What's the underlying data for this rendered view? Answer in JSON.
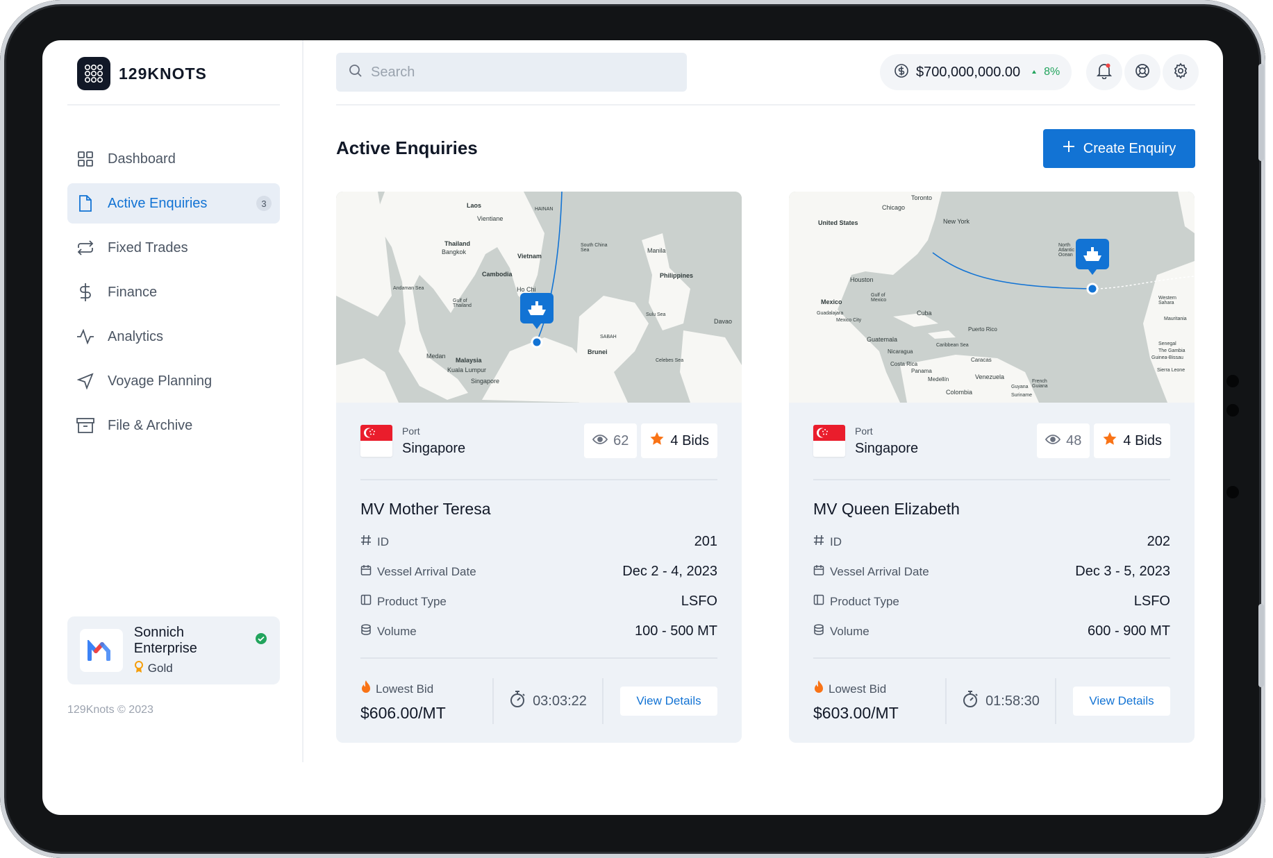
{
  "app": {
    "name": "129KNOTS"
  },
  "sidebar": {
    "items": [
      {
        "label": "Dashboard",
        "icon": "grid-icon"
      },
      {
        "label": "Active Enquiries",
        "icon": "document-icon",
        "badge": "3"
      },
      {
        "label": "Fixed Trades",
        "icon": "swap-icon"
      },
      {
        "label": "Finance",
        "icon": "dollar-icon"
      },
      {
        "label": "Analytics",
        "icon": "pulse-icon"
      },
      {
        "label": "Voyage Planning",
        "icon": "navigation-icon"
      },
      {
        "label": "File & Archive",
        "icon": "archive-icon"
      }
    ],
    "company": {
      "name": "Sonnich Enterprise",
      "tier": "Gold"
    },
    "copyright": "129Knots © 2023"
  },
  "header": {
    "search_placeholder": "Search",
    "balance": "$700,000,000.00",
    "balance_change": "8%"
  },
  "page": {
    "title": "Active Enquiries",
    "create_label": "Create Enquiry"
  },
  "labels": {
    "port": "Port",
    "id": "ID",
    "arrival": "Vessel Arrival Date",
    "product": "Product Type",
    "volume": "Volume",
    "lowest_bid": "Lowest Bid",
    "view_details": "View Details"
  },
  "map_labels": {
    "left": [
      "Laos",
      "Vientiane",
      "Thailand",
      "Bangkok",
      "Vietnam",
      "Cambodia",
      "Philippines",
      "Manila",
      "Ho Chi",
      "Malaysia",
      "Kuala Lumpur",
      "Singapore",
      "Medan",
      "Brunei",
      "Davao",
      "Andaman Sea",
      "South China Sea",
      "Sulu Sea",
      "Celebes Sea",
      "Gulf of Thailand",
      "HAINAN",
      "SABAH"
    ],
    "right": [
      "United States",
      "Chicago",
      "Toronto",
      "New York",
      "Houston",
      "Mexico",
      "Mexico City",
      "Guadalajara",
      "Cuba",
      "Guatemala",
      "Nicaragua",
      "Costa Rica",
      "Panama",
      "Venezuela",
      "Colombia",
      "Caracas",
      "Medellín",
      "Puerto Rico",
      "Guyana",
      "Suriname",
      "French Guiana",
      "Western Sahara",
      "Senegal",
      "The Gambia",
      "Guinea-Bissau",
      "Sierra Leone",
      "Mauritania",
      "Caribbean Sea",
      "Gulf of Mexico",
      "North Atlantic Ocean"
    ]
  },
  "enquiries": [
    {
      "port": "Singapore",
      "views": "62",
      "bids": "4 Bids",
      "vessel": "MV Mother Teresa",
      "id": "201",
      "arrival": "Dec 2 - 4, 2023",
      "product": "LSFO",
      "volume": "100 - 500 MT",
      "lowest_bid": "$606.00/MT",
      "timer": "03:03:22"
    },
    {
      "port": "Singapore",
      "views": "48",
      "bids": "4 Bids",
      "vessel": "MV Queen Elizabeth",
      "id": "202",
      "arrival": "Dec 3 - 5, 2023",
      "product": "LSFO",
      "volume": "600 - 900 MT",
      "lowest_bid": "$603.00/MT",
      "timer": "01:58:30"
    }
  ],
  "colors": {
    "accent": "#1273d4",
    "positive": "#22a45d",
    "card_bg": "#eef2f7",
    "flag_red": "#ea1d2c",
    "bid_star": "#f97316"
  }
}
